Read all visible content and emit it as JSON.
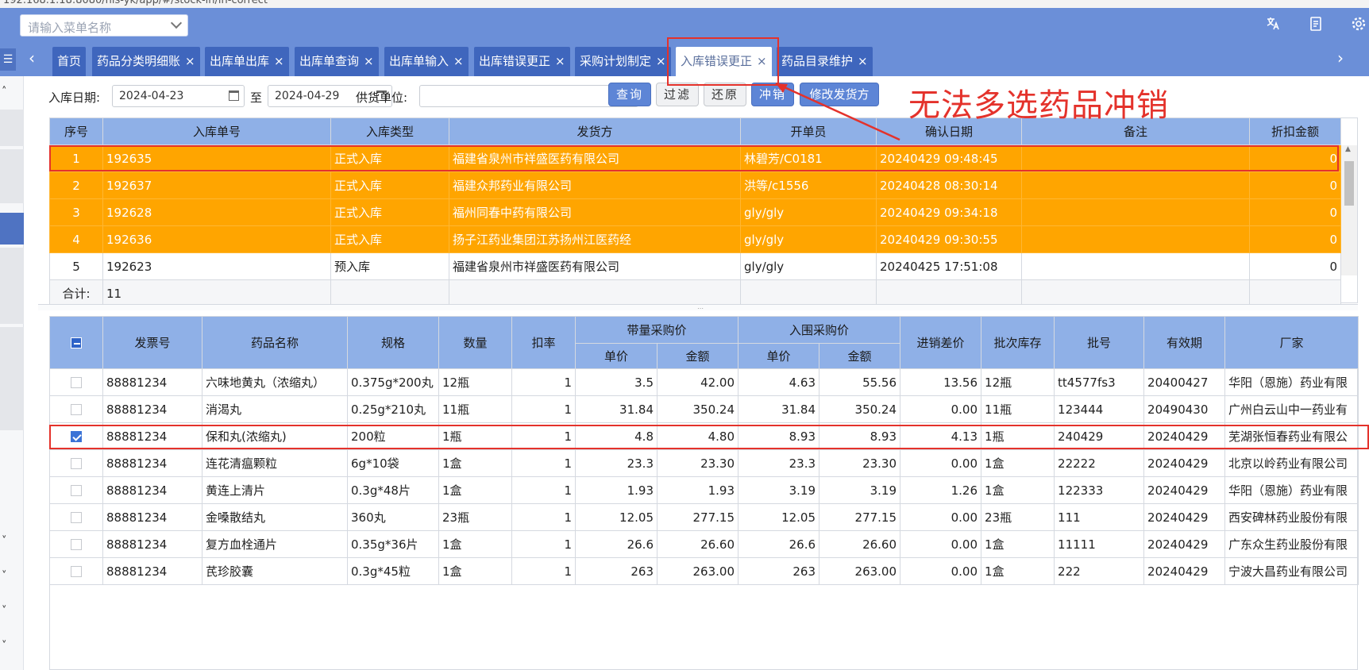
{
  "browser": {
    "url": "192.168.1.18:8080/his-yk/app/#/stock-in/in-correct"
  },
  "header": {
    "menu_search_placeholder": "请输入菜单名称",
    "icons": [
      "translate-icon",
      "document-icon",
      "gear-icon"
    ]
  },
  "tabs": [
    {
      "label": "首页",
      "closable": false,
      "active": false
    },
    {
      "label": "药品分类明细账",
      "closable": true,
      "active": false
    },
    {
      "label": "出库单出库",
      "closable": true,
      "active": false
    },
    {
      "label": "出库单查询",
      "closable": true,
      "active": false
    },
    {
      "label": "出库单输入",
      "closable": true,
      "active": false
    },
    {
      "label": "出库错误更正",
      "closable": true,
      "active": false
    },
    {
      "label": "采购计划制定",
      "closable": true,
      "active": false
    },
    {
      "label": "入库错误更正",
      "closable": true,
      "active": true
    },
    {
      "label": "药品目录维护",
      "closable": true,
      "active": false
    }
  ],
  "tab_close_glyph": "×",
  "filter": {
    "date_label": "入库日期:",
    "date_from": "2024-04-23",
    "date_sep": "至",
    "date_to": "2024-04-29",
    "supplier_label": "供货单位:",
    "supplier_value": "",
    "buttons": {
      "query": "查询",
      "filter": "过滤",
      "restore": "还原",
      "writeoff": "冲销",
      "modify_sender": "修改发货方"
    }
  },
  "annotation": {
    "text": "无法多选药品冲销",
    "color": "#e4322b"
  },
  "top_grid": {
    "columns": [
      "序号",
      "入库单号",
      "入库类型",
      "发货方",
      "开单员",
      "确认日期",
      "备注",
      "折扣金额"
    ],
    "rows": [
      {
        "seq": "1",
        "no": "192635",
        "type": "正式入库",
        "sender": "福建省泉州市祥盛医药有限公司",
        "clerk": "林碧芳/C0181",
        "date": "20240429 09:48:45",
        "note": "",
        "discount": "0",
        "highlight": true
      },
      {
        "seq": "2",
        "no": "192637",
        "type": "正式入库",
        "sender": "福建众邦药业有限公司",
        "clerk": "洪等/c1556",
        "date": "20240428 08:30:14",
        "note": "",
        "discount": "0",
        "highlight": true
      },
      {
        "seq": "3",
        "no": "192628",
        "type": "正式入库",
        "sender": "福州同春中药有限公司",
        "clerk": "gly/gly",
        "date": "20240429 09:34:18",
        "note": "",
        "discount": "0",
        "highlight": true
      },
      {
        "seq": "4",
        "no": "192636",
        "type": "正式入库",
        "sender": "扬子江药业集团江苏扬州江医药经",
        "clerk": "gly/gly",
        "date": "20240429 09:30:55",
        "note": "",
        "discount": "0",
        "highlight": true
      },
      {
        "seq": "5",
        "no": "192623",
        "type": "预入库",
        "sender": "福建省泉州市祥盛医药有限公司",
        "clerk": "gly/gly",
        "date": "20240425 17:51:08",
        "note": "",
        "discount": "0",
        "highlight": false
      }
    ],
    "total_label": "合计:",
    "total_value": "11"
  },
  "bottom_grid": {
    "header_top": [
      "发票号",
      "药品名称",
      "规格",
      "数量",
      "扣率",
      "带量采购价",
      "入围采购价",
      "进销差价",
      "批次库存",
      "批号",
      "有效期",
      "厂家"
    ],
    "header_sub": [
      "单价",
      "金额",
      "单价",
      "金额"
    ],
    "rows": [
      {
        "checked": false,
        "invoice": "88881234",
        "name": "六味地黄丸（浓缩丸）",
        "spec": "0.375g*200丸",
        "qty": "12瓶",
        "rate": "1",
        "dl_price": "3.5",
        "dl_amount": "42.00",
        "rw_price": "4.63",
        "rw_amount": "55.56",
        "diff": "13.56",
        "stock": "12瓶",
        "batch": "tt4577fs3",
        "expiry": "20400427",
        "maker": "华阳（恩施）药业有限"
      },
      {
        "checked": false,
        "invoice": "88881234",
        "name": "消渴丸",
        "spec": "0.25g*210丸",
        "qty": "11瓶",
        "rate": "1",
        "dl_price": "31.84",
        "dl_amount": "350.24",
        "rw_price": "31.84",
        "rw_amount": "350.24",
        "diff": "0.00",
        "stock": "11瓶",
        "batch": "123444",
        "expiry": "20490430",
        "maker": "广州白云山中一药业有"
      },
      {
        "checked": true,
        "invoice": "88881234",
        "name": "保和丸(浓缩丸)",
        "spec": "200粒",
        "qty": "1瓶",
        "rate": "1",
        "dl_price": "4.8",
        "dl_amount": "4.80",
        "rw_price": "8.93",
        "rw_amount": "8.93",
        "diff": "4.13",
        "stock": "1瓶",
        "batch": "240429",
        "expiry": "20240429",
        "maker": "芜湖张恒春药业有限公"
      },
      {
        "checked": false,
        "invoice": "88881234",
        "name": "连花清瘟颗粒",
        "spec": "6g*10袋",
        "qty": "1盒",
        "rate": "1",
        "dl_price": "23.3",
        "dl_amount": "23.30",
        "rw_price": "23.3",
        "rw_amount": "23.30",
        "diff": "0.00",
        "stock": "1盒",
        "batch": "22222",
        "expiry": "20240429",
        "maker": "北京以岭药业有限公司"
      },
      {
        "checked": false,
        "invoice": "88881234",
        "name": "黄连上清片",
        "spec": "0.3g*48片",
        "qty": "1盒",
        "rate": "1",
        "dl_price": "1.93",
        "dl_amount": "1.93",
        "rw_price": "3.19",
        "rw_amount": "3.19",
        "diff": "1.26",
        "stock": "1盒",
        "batch": "122333",
        "expiry": "20240429",
        "maker": "华阳（恩施）药业有限"
      },
      {
        "checked": false,
        "invoice": "88881234",
        "name": "金嗓散结丸",
        "spec": "360丸",
        "qty": "23瓶",
        "rate": "1",
        "dl_price": "12.05",
        "dl_amount": "277.15",
        "rw_price": "12.05",
        "rw_amount": "277.15",
        "diff": "0.00",
        "stock": "23瓶",
        "batch": "111",
        "expiry": "20240429",
        "maker": "西安碑林药业股份有限"
      },
      {
        "checked": false,
        "invoice": "88881234",
        "name": "复方血栓通片",
        "spec": "0.35g*36片",
        "qty": "1盒",
        "rate": "1",
        "dl_price": "26.6",
        "dl_amount": "26.60",
        "rw_price": "26.6",
        "rw_amount": "26.60",
        "diff": "0.00",
        "stock": "1盒",
        "batch": "11111",
        "expiry": "20240429",
        "maker": "广东众生药业股份有限"
      },
      {
        "checked": false,
        "invoice": "88881234",
        "name": "芪珍胶囊",
        "spec": "0.3g*45粒",
        "qty": "1盒",
        "rate": "1",
        "dl_price": "263",
        "dl_amount": "263.00",
        "rw_price": "263",
        "rw_amount": "263.00",
        "diff": "0.00",
        "stock": "1盒",
        "batch": "222",
        "expiry": "20240429",
        "maker": "宁波大昌药业有限公司"
      }
    ]
  }
}
